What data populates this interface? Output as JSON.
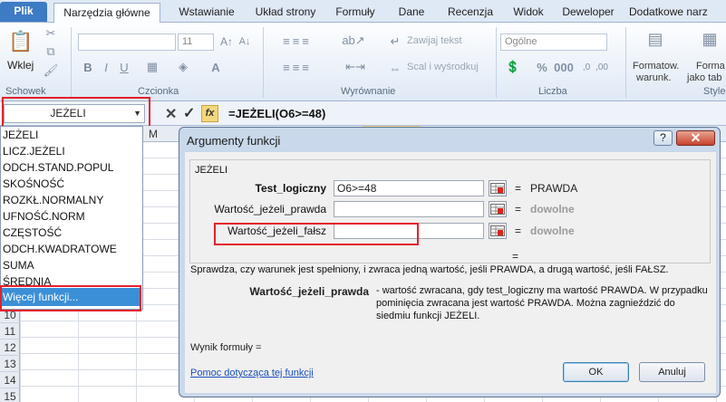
{
  "ribbon": {
    "tabs": [
      "Plik",
      "Narzędzia główne",
      "Wstawianie",
      "Układ strony",
      "Formuły",
      "Dane",
      "Recenzja",
      "Widok",
      "Deweloper",
      "Dodatkowe narz"
    ],
    "groups": {
      "clipboard": "Schowek",
      "font": "Czcionka",
      "alignment": "Wyrównanie",
      "number": "Liczba",
      "styles": "Style"
    },
    "paste_label": "Wklej",
    "font_size": "11",
    "wrap_text": "Zawijaj tekst",
    "merge_center": "Scal i wyśrodkuj",
    "number_format": "Ogólne",
    "cond_format_1": "Formatow.",
    "cond_format_2": "warunk.",
    "format_table_1": "Forma",
    "format_table_2": "jako tab"
  },
  "formula_bar": {
    "name_box": "JEŻELI",
    "fx": "fx",
    "formula": "=JEŻELI(O6>=48)"
  },
  "grid": {
    "column_visible": "M",
    "rows": [
      "10",
      "11",
      "12",
      "13",
      "14",
      "15"
    ]
  },
  "function_list": {
    "items": [
      "JEŻELI",
      "LICZ.JEŻELI",
      "ODCH.STAND.POPUL",
      "SKOŚNOŚĆ",
      "ROZKŁ.NORMALNY",
      "UFNOŚĆ.NORM",
      "CZĘSTOŚĆ",
      "ODCH.KWADRATOWE",
      "SUMA",
      "ŚREDNIA"
    ],
    "more": "Więcej funkcji..."
  },
  "dialog": {
    "title": "Argumenty funkcji",
    "help": "?",
    "function_name": "JEŻELI",
    "args": [
      {
        "label": "Test_logiczny",
        "value": "O6>=48",
        "result": "PRAWDA"
      },
      {
        "label": "Wartość_jeżeli_prawda",
        "value": "",
        "result": "dowolne"
      },
      {
        "label": "Wartość_jeżeli_fałsz",
        "value": "",
        "result": "dowolne"
      }
    ],
    "equals": "=",
    "description": "Sprawdza, czy warunek jest spełniony, i zwraca jedną wartość, jeśli PRAWDA, a drugą wartość, jeśli FAŁSZ.",
    "current_arg": "Wartość_jeżeli_prawda",
    "current_arg_desc": "- wartość zwracana, gdy test_logiczny ma wartość PRAWDA. W przypadku pominięcia zwracana jest wartość PRAWDA. Można zagnieździć do siedmiu funkcji JEŻELI.",
    "result_label": "Wynik formuły =",
    "help_link": "Pomoc dotycząca tej funkcji",
    "ok": "OK",
    "cancel": "Anuluj"
  }
}
